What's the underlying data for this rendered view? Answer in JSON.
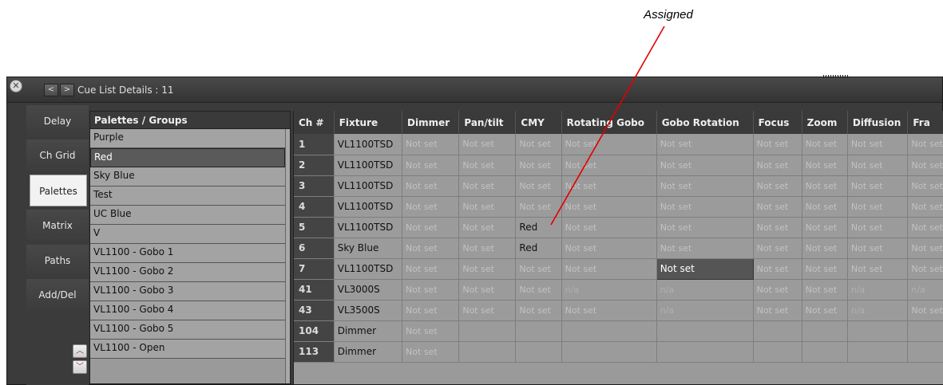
{
  "annotation": {
    "label": "Assigned"
  },
  "window": {
    "title": "Cue List Details : 11",
    "close_glyph": "✕",
    "prev_glyph": "<",
    "next_glyph": ">"
  },
  "sidebar": {
    "items": [
      {
        "label": "Delay",
        "active": false
      },
      {
        "label": "Ch Grid",
        "active": false
      },
      {
        "label": "Palettes",
        "active": true
      },
      {
        "label": "Matrix",
        "active": false
      },
      {
        "label": "Paths",
        "active": false
      },
      {
        "label": "Add/Del",
        "active": false
      }
    ],
    "scroll_up_glyph": "︿",
    "scroll_down_glyph": "﹀"
  },
  "palettes": {
    "header": "Palettes / Groups",
    "items": [
      "Purple",
      "Red",
      "Sky Blue",
      "Test",
      "UC Blue",
      "V",
      "VL1100  - Gobo 1",
      "VL1100  - Gobo 2",
      "VL1100  - Gobo 3",
      "VL1100  - Gobo 4",
      "VL1100  - Gobo 5",
      "VL1100  - Open"
    ],
    "selected": "Red"
  },
  "grid": {
    "columns": [
      "Ch #",
      "Fixture",
      "Dimmer",
      "Pan/tilt",
      "CMY",
      "Rotating Gobo",
      "Gobo Rotation",
      "Focus",
      "Zoom",
      "Diffusion",
      "Fra"
    ],
    "rows": [
      [
        "1",
        "VL1100TSD",
        "Not set",
        "Not set",
        "Not set",
        "Not set",
        "Not set",
        "Not set",
        "Not set",
        "Not set",
        "Not set"
      ],
      [
        "2",
        "VL1100TSD",
        "Not set",
        "Not set",
        "Not set",
        "Not set",
        "Not set",
        "Not set",
        "Not set",
        "Not set",
        "Not set"
      ],
      [
        "3",
        "VL1100TSD",
        "Not set",
        "Not set",
        "Not set",
        "Not set",
        "Not set",
        "Not set",
        "Not set",
        "Not set",
        "Not set"
      ],
      [
        "4",
        "VL1100TSD",
        "Not set",
        "Not set",
        "Not set",
        "Not set",
        "Not set",
        "Not set",
        "Not set",
        "Not set",
        "Not set"
      ],
      [
        "5",
        "VL1100TSD",
        "Not set",
        "Not set",
        "Red",
        "Not set",
        "Not set",
        "Not set",
        "Not set",
        "Not set",
        "Not set"
      ],
      [
        "6",
        "Sky Blue",
        "Not set",
        "Not set",
        "Red",
        "Not set",
        "Not set",
        "Not set",
        "Not set",
        "Not set",
        "Not set"
      ],
      [
        "7",
        "VL1100TSD",
        "Not set",
        "Not set",
        "Not set",
        "Not set",
        "Not set",
        "Not set",
        "Not set",
        "Not set",
        "Not set"
      ],
      [
        "41",
        "VL3000S",
        "Not set",
        "Not set",
        "Not set",
        "n/a",
        "n/a",
        "Not set",
        "Not set",
        "n/a",
        "n/a"
      ],
      [
        "43",
        "VL3500S",
        "Not set",
        "Not set",
        "Not set",
        "Not set",
        "n/a",
        "Not set",
        "Not set",
        "n/a",
        "Not set"
      ],
      [
        "104",
        "Dimmer",
        "Not set",
        "",
        "",
        "",
        "",
        "",
        "",
        "",
        ""
      ],
      [
        "113",
        "Dimmer",
        "Not set",
        "",
        "",
        "",
        "",
        "",
        "",
        "",
        ""
      ]
    ],
    "highlight_cell": {
      "row": 6,
      "col": 6
    }
  }
}
